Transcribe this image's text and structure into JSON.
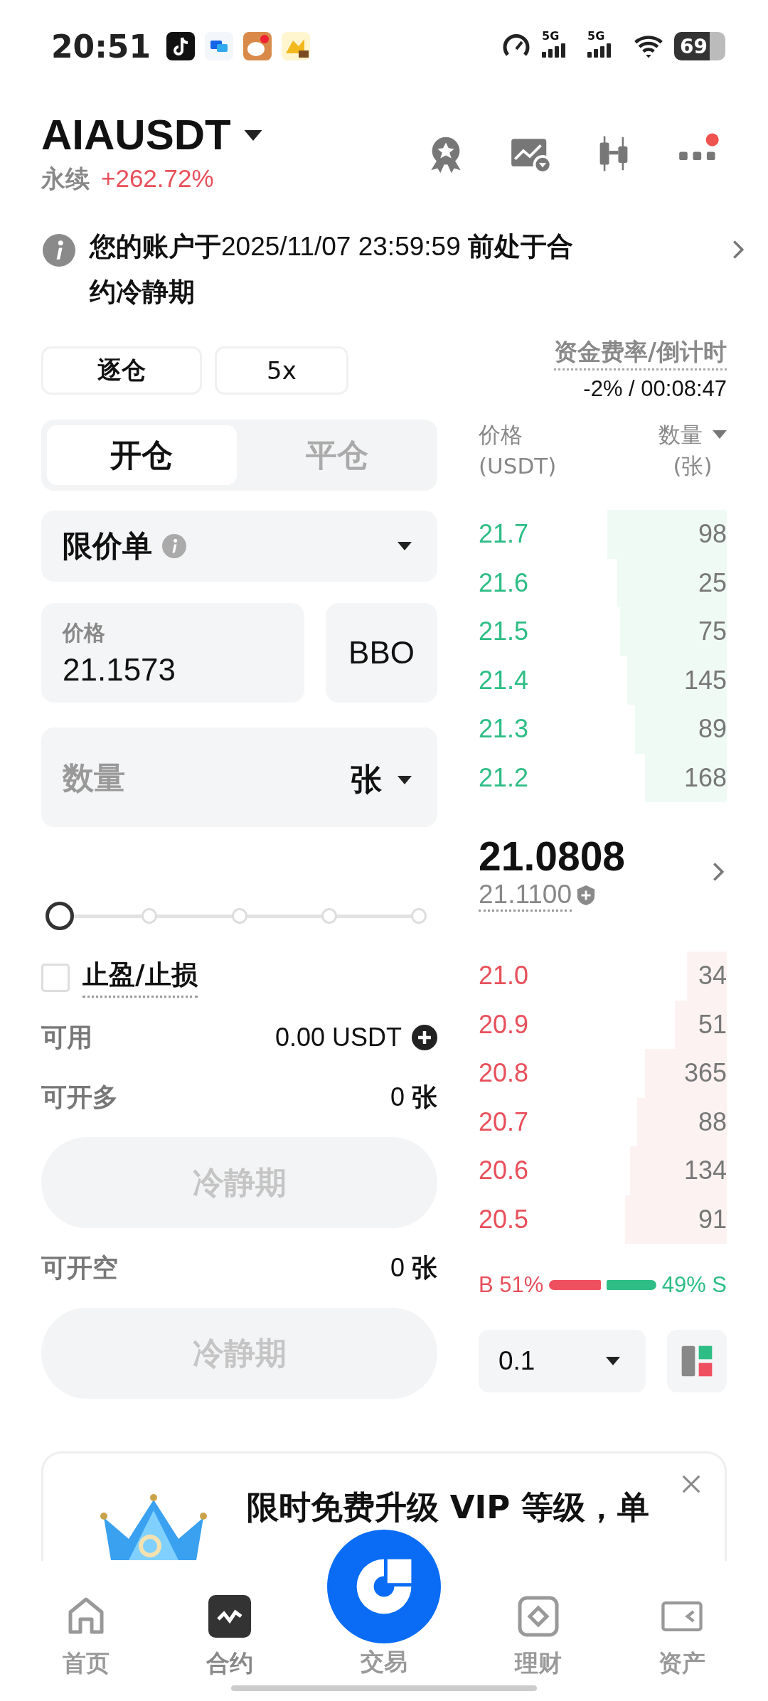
{
  "status_bar": {
    "time": "20:51",
    "network_1": "5G",
    "network_2": "5G",
    "battery": "69"
  },
  "header": {
    "symbol": "AIAUSDT",
    "type": "永续",
    "change": "+262.72%"
  },
  "notice": {
    "text": "**您的账户于**2025/11/07 23:59:59 **前处于合约冷静期**"
  },
  "margin": {
    "mode": "逐仓",
    "leverage": "5x"
  },
  "funding": {
    "label": "资金费率/倒计时",
    "value": "-2% / 00:08:47"
  },
  "position_tabs": [
    {
      "label": "开仓",
      "selected": true
    },
    {
      "label": "平仓",
      "selected": false
    }
  ],
  "order_type": {
    "label": "限价单"
  },
  "price_field": {
    "label": "价格",
    "value": "21.1573"
  },
  "bbo_button": {
    "label": "BBO"
  },
  "quantity_field": {
    "placeholder": "数量",
    "unit": "张"
  },
  "slider": {
    "level": 0
  },
  "tp_sl": {
    "label": "止盈/止损",
    "checked": false
  },
  "available": {
    "label": "可用",
    "value": "0.00 USDT"
  },
  "actions": [
    {
      "label": "可开多",
      "amount": "0",
      "unit": "张",
      "button": "冷静期"
    },
    {
      "label": "可开空",
      "amount": "0",
      "unit": "张",
      "button": "冷静期"
    }
  ],
  "order_book": {
    "price_header": "价格",
    "price_unit": "(USDT)",
    "qty_header": "数量",
    "qty_unit": "(张)",
    "asks": [
      {
        "price": "21.7",
        "qty": "98"
      },
      {
        "price": "21.6",
        "qty": "25"
      },
      {
        "price": "21.5",
        "qty": "75"
      },
      {
        "price": "21.4",
        "qty": "145"
      },
      {
        "price": "21.3",
        "qty": "89"
      },
      {
        "price": "21.2",
        "qty": "168"
      }
    ],
    "last_price": "21.0808",
    "mark_price": "21.1100",
    "bids": [
      {
        "price": "21.0",
        "qty": "34"
      },
      {
        "price": "20.9",
        "qty": "51"
      },
      {
        "price": "20.8",
        "qty": "365"
      },
      {
        "price": "20.7",
        "qty": "88"
      },
      {
        "price": "20.6",
        "qty": "134"
      },
      {
        "price": "20.5",
        "qty": "91"
      }
    ],
    "ratio": {
      "buy": "B 51%",
      "sell": "49% S"
    },
    "precision": "0.1"
  },
  "banner": {
    "text": "限时免费升级 VIP 等级，单"
  },
  "nav": [
    {
      "label": "首页",
      "kind": "home",
      "selected": false
    },
    {
      "label": "合约",
      "kind": "futures",
      "selected": true
    },
    {
      "label": "交易",
      "kind": "trade",
      "selected": false
    },
    {
      "label": "理财",
      "kind": "earn",
      "selected": false
    },
    {
      "label": "资产",
      "kind": "assets",
      "selected": false
    }
  ]
}
